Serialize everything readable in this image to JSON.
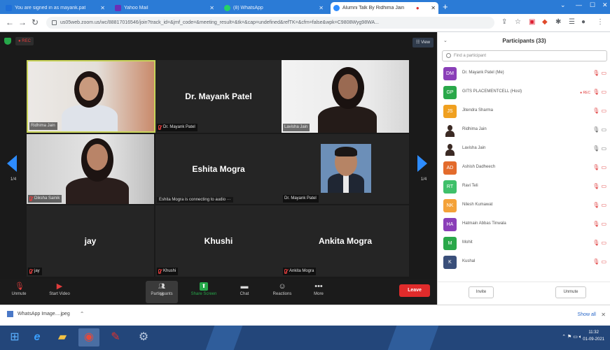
{
  "browser": {
    "tabs": [
      {
        "title": "You are signed in as mayank.pat",
        "favicon_color": "#1e6fd9"
      },
      {
        "title": "Yahoo Mail",
        "favicon_color": "#6b2fb5"
      },
      {
        "title": "(8) WhatsApp",
        "favicon_color": "#25d366"
      },
      {
        "title": "Alumni Talk By Ridhima Jain",
        "favicon_color": "#2d8cff"
      }
    ],
    "new_tab": "+",
    "address": "us05web.zoom.us/wc/88817016546/join?track_id=&jmf_code=&meeting_result=&tk=&cap=undefined&refTK=&cfm=false&wpk=C9808Wyg98WA..."
  },
  "meeting": {
    "rec_label": "● REC",
    "view_label": "☷ View",
    "page_indicator": "1/4",
    "tiles": [
      {
        "name": "Ridhima Jain",
        "type": "video",
        "speaking": true
      },
      {
        "name": "Dr. Mayank Patel",
        "type": "name",
        "label": "Dr. Mayank Patel"
      },
      {
        "name": "Lavisha Jain",
        "type": "video"
      },
      {
        "name": "Diksha Sainik",
        "type": "video"
      },
      {
        "name": "Eshita Mogra",
        "type": "name",
        "status": "Eshita Mogra is connecting to audio ···"
      },
      {
        "name": "Dr. Mayank Patel",
        "type": "photo"
      },
      {
        "name": "jay",
        "type": "name",
        "label": "jay"
      },
      {
        "name": "Khushi",
        "type": "name",
        "label": "Khushi"
      },
      {
        "name": "Ankita Mogra",
        "type": "name",
        "label": "Ankita Mogra"
      }
    ],
    "toolbar": {
      "unmute": "Unmute",
      "start_video": "Start Video",
      "participants": "Participants",
      "participants_count": "33",
      "share_screen": "Share Screen",
      "chat": "Chat",
      "reactions": "Reactions",
      "more": "More",
      "leave": "Leave"
    }
  },
  "participants_panel": {
    "title": "Participants (33)",
    "search_placeholder": "Find a participant",
    "items": [
      {
        "initials": "DM",
        "name": "Dr. Mayank Patel (Me)",
        "color": "#8a3fb8"
      },
      {
        "initials": "GP",
        "name": "GITS PLACEMENTCELL (Host)",
        "color": "#2aa84a",
        "rec": "● REC"
      },
      {
        "initials": "JS",
        "name": "Jitendra Sharma",
        "color": "#f0a020"
      },
      {
        "initials": "",
        "name": "Ridhima Jain",
        "color": "#ffffff",
        "photo": true
      },
      {
        "initials": "",
        "name": "Lavisha Jain",
        "color": "#ffffff",
        "photo": true
      },
      {
        "initials": "AD",
        "name": "Ashish Dadheech",
        "color": "#e36b2c"
      },
      {
        "initials": "RT",
        "name": "Ravi Teli",
        "color": "#3fc06a"
      },
      {
        "initials": "NK",
        "name": "Nilesh Kumawat",
        "color": "#f4a238"
      },
      {
        "initials": "HA",
        "name": "Hatmain Abbas Tinwala",
        "color": "#8a3fb8"
      },
      {
        "initials": "M",
        "name": "Mohit",
        "color": "#2aa84a"
      },
      {
        "initials": "K",
        "name": "Kushal",
        "color": "#3a4f7a"
      }
    ],
    "invite": "Invite",
    "unmute_me": "Unmute"
  },
  "downloads": {
    "file": "WhatsApp Image....jpeg",
    "show_all": "Show all"
  },
  "taskbar": {
    "time": "11:32",
    "date": "01-09-2021"
  }
}
